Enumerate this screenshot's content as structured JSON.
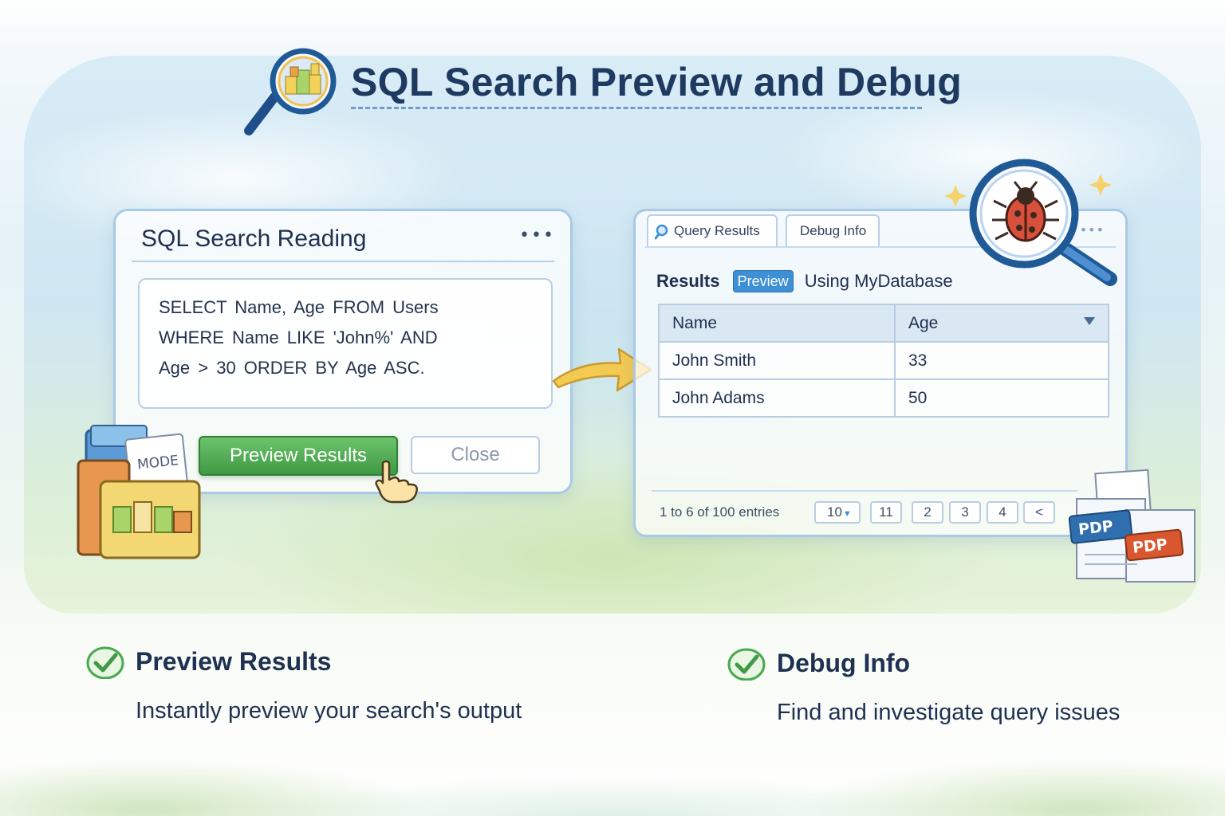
{
  "header": {
    "title": "SQL Search Preview and Debug"
  },
  "sql_panel": {
    "title": "SQL Search Reading",
    "more_label": "•••",
    "query_lines": [
      "SELECT Name, Age FROM Users",
      "WHERE Name LIKE 'John%' AND",
      "Age > 30 ORDER BY Age ASC."
    ],
    "preview_button_label": "Preview Results",
    "close_button_label": "Close",
    "folder_tag": "MODE"
  },
  "results_panel": {
    "tabs": [
      {
        "label": "Query Results",
        "icon": "search-icon"
      },
      {
        "label": "Debug Info"
      }
    ],
    "tabs_more_label": "•••",
    "results_label": "Results",
    "preview_badge": "Preview",
    "database_label": "Using MyDatabase",
    "table": {
      "columns": [
        "Name",
        "Age"
      ],
      "rows": [
        [
          "John Smith",
          "33"
        ],
        [
          "John Adams",
          "50"
        ]
      ]
    },
    "pagination": {
      "info": "1 to 6 of 100 entries",
      "page_size": "10",
      "pages": [
        "11",
        "2",
        "3",
        "4"
      ],
      "prev_label": "<"
    },
    "pdf_labels": [
      "PDP",
      "PDP"
    ]
  },
  "features": [
    {
      "title": "Preview Results",
      "description": "Instantly preview your search's output"
    },
    {
      "title": "Debug Info",
      "description": "Find and investigate query issues"
    }
  ],
  "colors": {
    "accent_green": "#4aa84f",
    "accent_blue": "#3d8fd6",
    "text_dark": "#1f3150"
  }
}
